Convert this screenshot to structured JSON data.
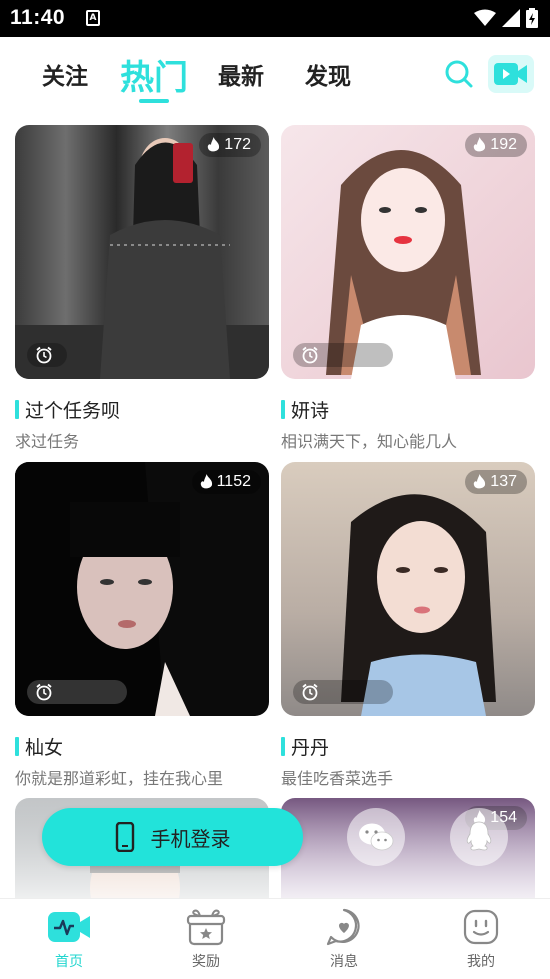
{
  "statusbar": {
    "time": "11:40",
    "a_icon": "A"
  },
  "tabs": [
    {
      "label": "关注",
      "active": false
    },
    {
      "label": "热门",
      "active": true
    },
    {
      "label": "最新",
      "active": false
    },
    {
      "label": "发现",
      "active": false
    }
  ],
  "header_icons": {
    "search": "search-icon",
    "video": "video-camera-icon"
  },
  "cards": [
    {
      "name": "过个任务呗",
      "motto": "求过任务",
      "heat": "172"
    },
    {
      "name": "妍诗",
      "motto": "相识满天下，知心能几人",
      "heat": "192"
    },
    {
      "name": "杣女",
      "motto": "你就是那道彩虹，挂在我心里",
      "heat": "1152"
    },
    {
      "name": "丹丹",
      "motto": "最佳吃香菜选手",
      "heat": "137"
    },
    {
      "heat": ""
    },
    {
      "heat": "154"
    }
  ],
  "login": {
    "label": "手机登录"
  },
  "bottom_nav": [
    {
      "label": "首页",
      "active": true
    },
    {
      "label": "奖励",
      "active": false
    },
    {
      "label": "消息",
      "active": false
    },
    {
      "label": "我的",
      "active": false
    }
  ],
  "colors": {
    "accent": "#2ee0dc",
    "login_button": "#22e3da"
  }
}
